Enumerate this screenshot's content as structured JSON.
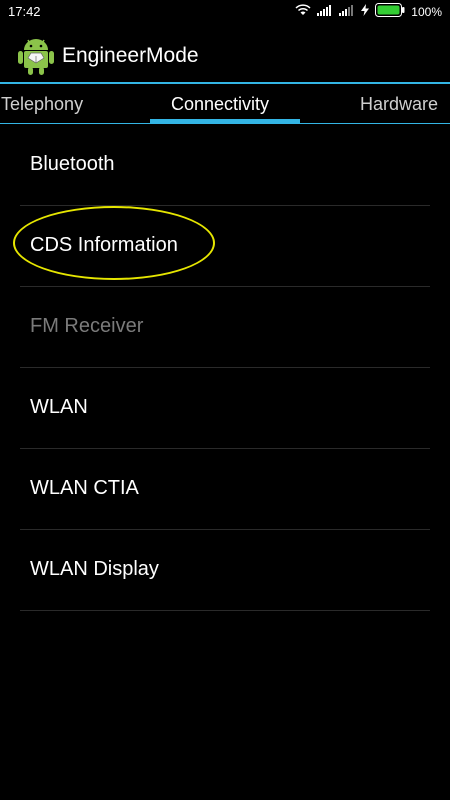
{
  "status_bar": {
    "time": "17:42",
    "battery_percent": "100%",
    "icons": [
      "wifi-icon",
      "signal-icon",
      "signal-icon",
      "charging-icon",
      "battery-icon"
    ],
    "battery_color": "#33cc33"
  },
  "action_bar": {
    "title": "EngineerMode",
    "icon": "android-icon"
  },
  "tabs": [
    {
      "label": "Telephony",
      "active": false
    },
    {
      "label": "Connectivity",
      "active": true
    },
    {
      "label": "Hardware",
      "active": false
    }
  ],
  "list": [
    {
      "label": "Bluetooth",
      "enabled": true
    },
    {
      "label": "CDS Information",
      "enabled": true,
      "annotated": true
    },
    {
      "label": "FM Receiver",
      "enabled": false
    },
    {
      "label": "WLAN",
      "enabled": true
    },
    {
      "label": "WLAN CTIA",
      "enabled": true
    },
    {
      "label": "WLAN Display",
      "enabled": true
    }
  ],
  "colors": {
    "accent": "#33b5e5",
    "annotation": "#e6e600",
    "disabled_text": "#7a7a7a"
  }
}
